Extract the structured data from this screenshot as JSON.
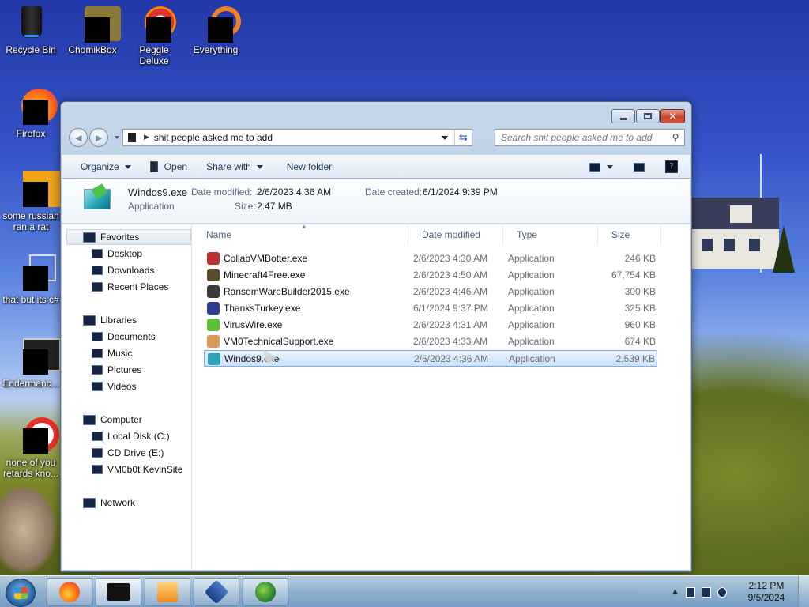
{
  "desktop": {
    "icons": [
      {
        "id": "recycle-bin",
        "label": "Recycle Bin"
      },
      {
        "id": "chomikbox",
        "label": "ChomikBox"
      },
      {
        "id": "peggle-deluxe",
        "label": "Peggle Deluxe"
      },
      {
        "id": "everything",
        "label": "Everything"
      },
      {
        "id": "firefox",
        "label": "Firefox"
      },
      {
        "id": "some-russian",
        "label": "some russian ran a rat"
      },
      {
        "id": "that-but-c",
        "label": "that but its c#"
      },
      {
        "id": "endermanch",
        "label": "Endermanc..."
      },
      {
        "id": "none-of-you",
        "label": "none of you retards kno..."
      }
    ]
  },
  "window": {
    "address_path": "shit people asked me to add",
    "search_placeholder": "Search shit people asked me to add",
    "toolbar": {
      "organize": "Organize",
      "open": "Open",
      "share_with": "Share with",
      "new_folder": "New folder"
    },
    "details": {
      "file_name": "Windos9.exe",
      "file_type": "Application",
      "date_modified_label": "Date modified:",
      "date_modified": "2/6/2023 4:36 AM",
      "size_label": "Size:",
      "size": "2.47 MB",
      "date_created_label": "Date created:",
      "date_created": "6/1/2024 9:39 PM"
    },
    "nav": {
      "favorites": "Favorites",
      "desktop": "Desktop",
      "downloads": "Downloads",
      "recent_places": "Recent Places",
      "libraries": "Libraries",
      "documents": "Documents",
      "music": "Music",
      "pictures": "Pictures",
      "videos": "Videos",
      "computer": "Computer",
      "local_disk": "Local Disk (C:)",
      "cd_drive": "CD Drive (E:)",
      "vm_site": "VM0b0t KevinSite",
      "network": "Network"
    },
    "columns": {
      "name": "Name",
      "date_modified": "Date modified",
      "type": "Type",
      "size": "Size"
    },
    "files": [
      {
        "name": "CollabVMBotter.exe",
        "date": "2/6/2023 4:30 AM",
        "type": "Application",
        "size": "246 KB",
        "icon_color": "#b8322e"
      },
      {
        "name": "Minecraft4Free.exe",
        "date": "2/6/2023 4:50 AM",
        "type": "Application",
        "size": "67,754 KB",
        "icon_color": "#5a4a2a"
      },
      {
        "name": "RansomWareBuilder2015.exe",
        "date": "2/6/2023 4:46 AM",
        "type": "Application",
        "size": "300 KB",
        "icon_color": "#3a3a3a"
      },
      {
        "name": "ThanksTurkey.exe",
        "date": "6/1/2024 9:37 PM",
        "type": "Application",
        "size": "325 KB",
        "icon_color": "#2b3f8e"
      },
      {
        "name": "VirusWire.exe",
        "date": "2/6/2023 4:31 AM",
        "type": "Application",
        "size": "960 KB",
        "icon_color": "#5bbf3a"
      },
      {
        "name": "VM0TechnicalSupport.exe",
        "date": "2/6/2023 4:33 AM",
        "type": "Application",
        "size": "674 KB",
        "icon_color": "#d79a5a"
      },
      {
        "name": "Windos9.exe",
        "date": "2/6/2023 4:36 AM",
        "type": "Application",
        "size": "2,539 KB",
        "icon_color": "#2fa3b8",
        "selected": true
      }
    ]
  },
  "taskbar": {
    "time": "2:12 PM",
    "date": "9/5/2024"
  }
}
